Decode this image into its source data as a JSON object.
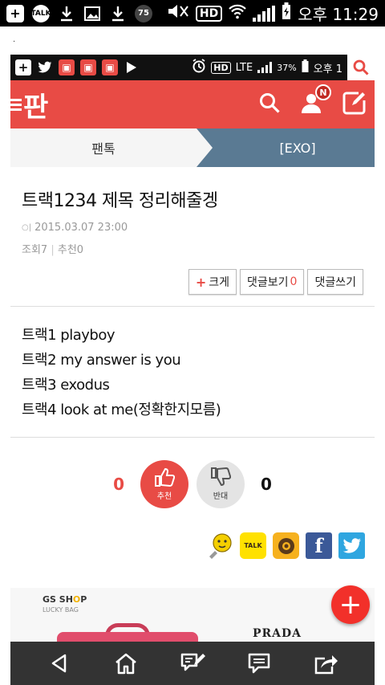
{
  "device_status": {
    "time": "오후 11:29",
    "notification_badge_number": "75",
    "talk_label": "TALK",
    "hd_label": "HD"
  },
  "separator": ".",
  "inner_status": {
    "hd_label": "HD",
    "lte_label": "LTE",
    "battery": "37%",
    "time_partial": "오후 1"
  },
  "appbar": {
    "logo": "판",
    "notification_badge": "N"
  },
  "breadcrumb": {
    "category": "팬톡",
    "subcategory": "[EXO]"
  },
  "post": {
    "title": "트랙1234 제목 정리해줄겡",
    "date": "2015.03.07 23:00",
    "views": "조회7",
    "recommend": "추천0",
    "enlarge_label": "크게",
    "view_comments_label": "댓글보기",
    "comment_count": "0",
    "write_comment_label": "댓글쓰기",
    "body_lines": [
      "트랙1 playboy",
      "트랙2 my answer is you",
      "트랙3 exodus",
      "트랙4 look at me(정확한지모름)"
    ]
  },
  "votes": {
    "up_count": "0",
    "up_label": "추천",
    "down_label": "반대",
    "down_count": "0"
  },
  "share": {
    "kakao_label": "TALK",
    "facebook_glyph": "f"
  },
  "ad": {
    "brand_logo_line1": "GS SH",
    "brand_logo_highlight": "O",
    "brand_logo_line1_end": "P",
    "brand_logo_line2": "LUCKY BAG",
    "product_brand": "PRADA"
  },
  "fab": {
    "glyph": "+"
  },
  "colors": {
    "accent": "#e84b45",
    "breadcrumb_active": "#5a7a93",
    "fab": "#f2302a",
    "nav": "#333333"
  }
}
